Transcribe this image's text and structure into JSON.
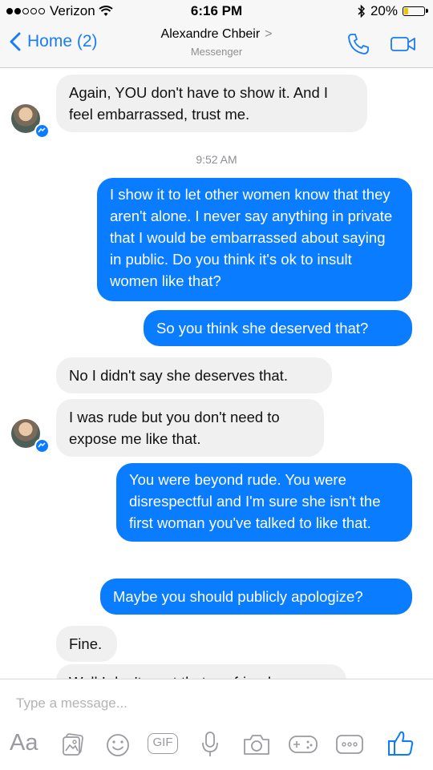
{
  "status_bar": {
    "carrier": "Verizon",
    "time": "6:16 PM",
    "battery": "20%",
    "battery_level": 0.2
  },
  "nav": {
    "back_label": "Home (2)",
    "contact_name": "Alexandre Chbeir",
    "subtitle": "Messenger"
  },
  "messages": {
    "m1": "Again, YOU don't have to show it. And I feel embarrassed, trust me.",
    "timestamp": "9:52 AM",
    "m2": "I show it to let other women know that they aren't alone.  I never say anything in private that I would be embarrassed about saying in public.  Do you think it's ok to insult women like that?",
    "m3": "So you think she deserved that?",
    "m4": "No I didn't say she deserves that.",
    "m5": "I was rude but you don't need to expose me like that.",
    "m6": "You were beyond rude.  You were disrespectful and I'm sure she isn't the first woman you've talked to like that.",
    "m7": "Maybe you should publicly apologize?",
    "m8": "Fine.",
    "m9": "Well I don't want that my friends or"
  },
  "composer": {
    "placeholder": "Type a message...",
    "aa_label": "Aa",
    "gif_label": "GIF"
  },
  "colors": {
    "accent": "#0a7cff",
    "incoming_bubble": "#f0f0f0"
  }
}
